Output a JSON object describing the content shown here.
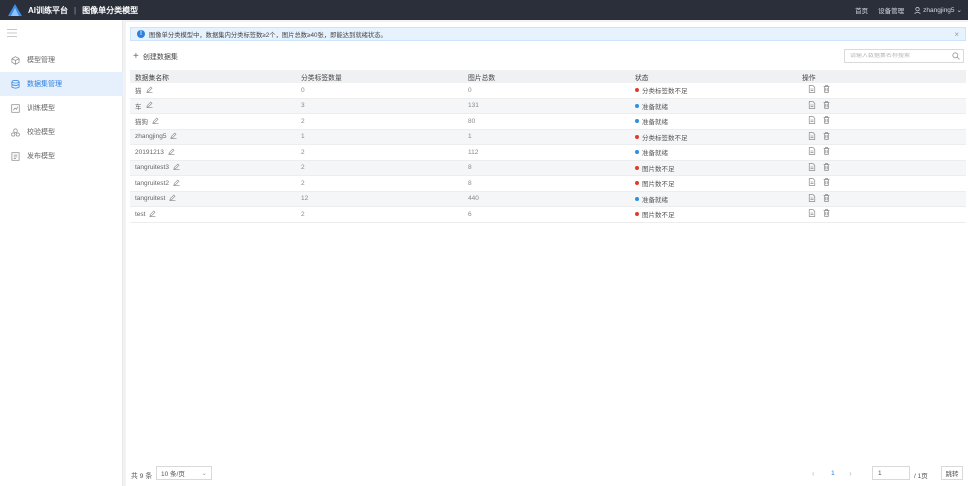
{
  "header": {
    "app_title": "AI训练平台",
    "separator": "|",
    "page_title": "图像单分类模型",
    "links": [
      "首页",
      "设备管理"
    ],
    "user": "zhangjing5",
    "logo_icon": "triangle-logo-icon",
    "accent": "#2d7fe0"
  },
  "sidebar": {
    "items": [
      {
        "label": "模型管理",
        "icon": "cube-icon",
        "active": false
      },
      {
        "label": "数据集管理",
        "icon": "dataset-icon",
        "active": true
      },
      {
        "label": "训练模型",
        "icon": "train-icon",
        "active": false
      },
      {
        "label": "校验模型",
        "icon": "verify-icon",
        "active": false
      },
      {
        "label": "发布模型",
        "icon": "publish-icon",
        "active": false
      }
    ]
  },
  "alert": {
    "text": "图像单分类模型中，数据集内分类标签数≥2个，图片总数≥40张，即能达到就绪状态。"
  },
  "toolbar": {
    "create_label": "创建数据集",
    "search_placeholder": "请输入数据集名称搜索"
  },
  "table": {
    "headers": [
      "数据集名称",
      "分类标签数量",
      "图片总数",
      "状态",
      "操作"
    ],
    "rows": [
      {
        "name": "猫",
        "labels": "0",
        "images": "0",
        "status": "分类标签数不足",
        "ok": false
      },
      {
        "name": "车",
        "labels": "3",
        "images": "131",
        "status": "准备就绪",
        "ok": true
      },
      {
        "name": "猫狗",
        "labels": "2",
        "images": "80",
        "status": "准备就绪",
        "ok": true
      },
      {
        "name": "zhangjing5",
        "labels": "1",
        "images": "1",
        "status": "分类标签数不足",
        "ok": false
      },
      {
        "name": "20191213",
        "labels": "2",
        "images": "112",
        "status": "准备就绪",
        "ok": true
      },
      {
        "name": "tangruitest3",
        "labels": "2",
        "images": "8",
        "status": "图片数不足",
        "ok": false
      },
      {
        "name": "tangruitest2",
        "labels": "2",
        "images": "8",
        "status": "图片数不足",
        "ok": false
      },
      {
        "name": "tangruitest",
        "labels": "12",
        "images": "440",
        "status": "准备就绪",
        "ok": true
      },
      {
        "name": "test",
        "labels": "2",
        "images": "6",
        "status": "图片数不足",
        "ok": false
      }
    ],
    "status_colors": {
      "ok": "#2d8fe0",
      "bad": "#e03a2d"
    }
  },
  "pagination": {
    "total": "共 9 条",
    "page_size": "10 条/页",
    "current": "1",
    "page_input": "1",
    "of_pages": "/ 1页",
    "jump": "跳转"
  }
}
